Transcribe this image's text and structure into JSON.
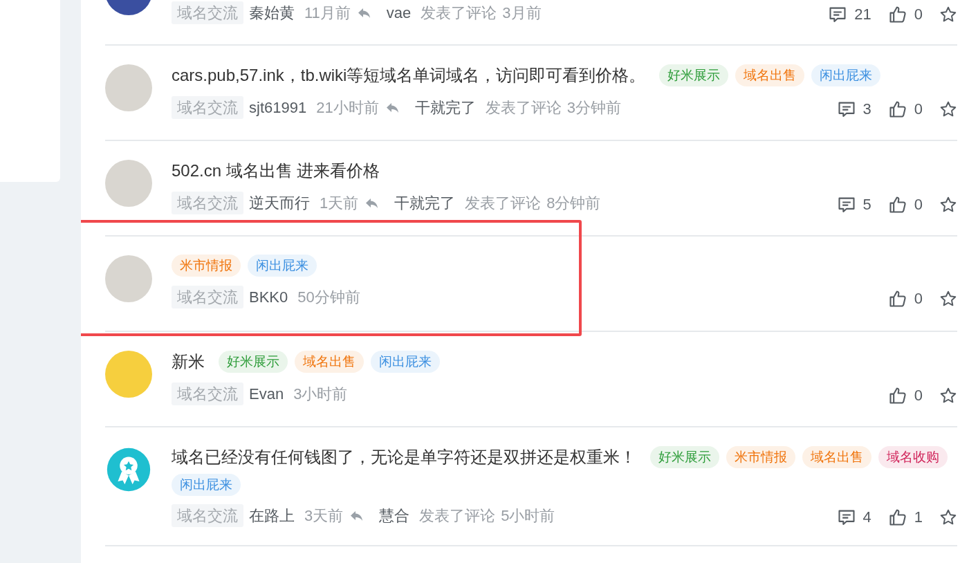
{
  "posts": [
    {
      "kind": "cartoon",
      "highlighted": false,
      "category": "域名交流",
      "author": "秦始黄",
      "time": "11月前",
      "reply": {
        "user": "vae",
        "action": "发表了评论",
        "time": "3月前"
      },
      "comments": "21",
      "likes": "0"
    },
    {
      "kind": "face",
      "highlighted": false,
      "title": "cars.pub,57.ink，tb.wiki等短域名单词域名，访问即可看到价格。",
      "tags": [
        {
          "label": "好米展示",
          "color": "#2e9d3a"
        },
        {
          "label": "域名出售",
          "color": "#f0740c"
        },
        {
          "label": "闲出屁来",
          "color": "#3b8fe0"
        }
      ],
      "category": "域名交流",
      "author": "sjt61991",
      "time": "21小时前",
      "reply": {
        "user": "干就完了",
        "action": "发表了评论",
        "time": "3分钟前"
      },
      "comments": "3",
      "likes": "0"
    },
    {
      "kind": "face",
      "highlighted": false,
      "title": "502.cn 域名出售 进来看价格",
      "category": "域名交流",
      "author": "逆天而行",
      "time": "1天前",
      "reply": {
        "user": "干就完了",
        "action": "发表了评论",
        "time": "8分钟前"
      },
      "comments": "5",
      "likes": "0"
    },
    {
      "kind": "face",
      "highlighted": true,
      "tags": [
        {
          "label": "米市情报",
          "color": "#f0740c"
        },
        {
          "label": "闲出屁来",
          "color": "#3b8fe0"
        }
      ],
      "category": "域名交流",
      "author": "BKK0",
      "time": "50分钟前",
      "likes": "0"
    },
    {
      "kind": "animal",
      "highlighted": false,
      "title": "新米",
      "tags": [
        {
          "label": "好米展示",
          "color": "#2e9d3a"
        },
        {
          "label": "域名出售",
          "color": "#f0740c"
        },
        {
          "label": "闲出屁来",
          "color": "#3b8fe0"
        }
      ],
      "category": "域名交流",
      "author": "Evan",
      "time": "3小时前",
      "likes": "0"
    },
    {
      "kind": "badge",
      "highlighted": false,
      "title": "域名已经没有任何钱图了，无论是单字符还是双拼还是权重米！",
      "tags": [
        {
          "label": "好米展示",
          "color": "#2e9d3a"
        },
        {
          "label": "米市情报",
          "color": "#f0740c"
        },
        {
          "label": "域名出售",
          "color": "#f0740c"
        },
        {
          "label": "域名收购",
          "color": "#d0245a"
        },
        {
          "label": "闲出屁来",
          "color": "#3b8fe0"
        }
      ],
      "category": "域名交流",
      "author": "在路上",
      "time": "3天前",
      "reply": {
        "user": "慧合",
        "action": "发表了评论",
        "time": "5小时前"
      },
      "comments": "4",
      "likes": "1"
    }
  ]
}
